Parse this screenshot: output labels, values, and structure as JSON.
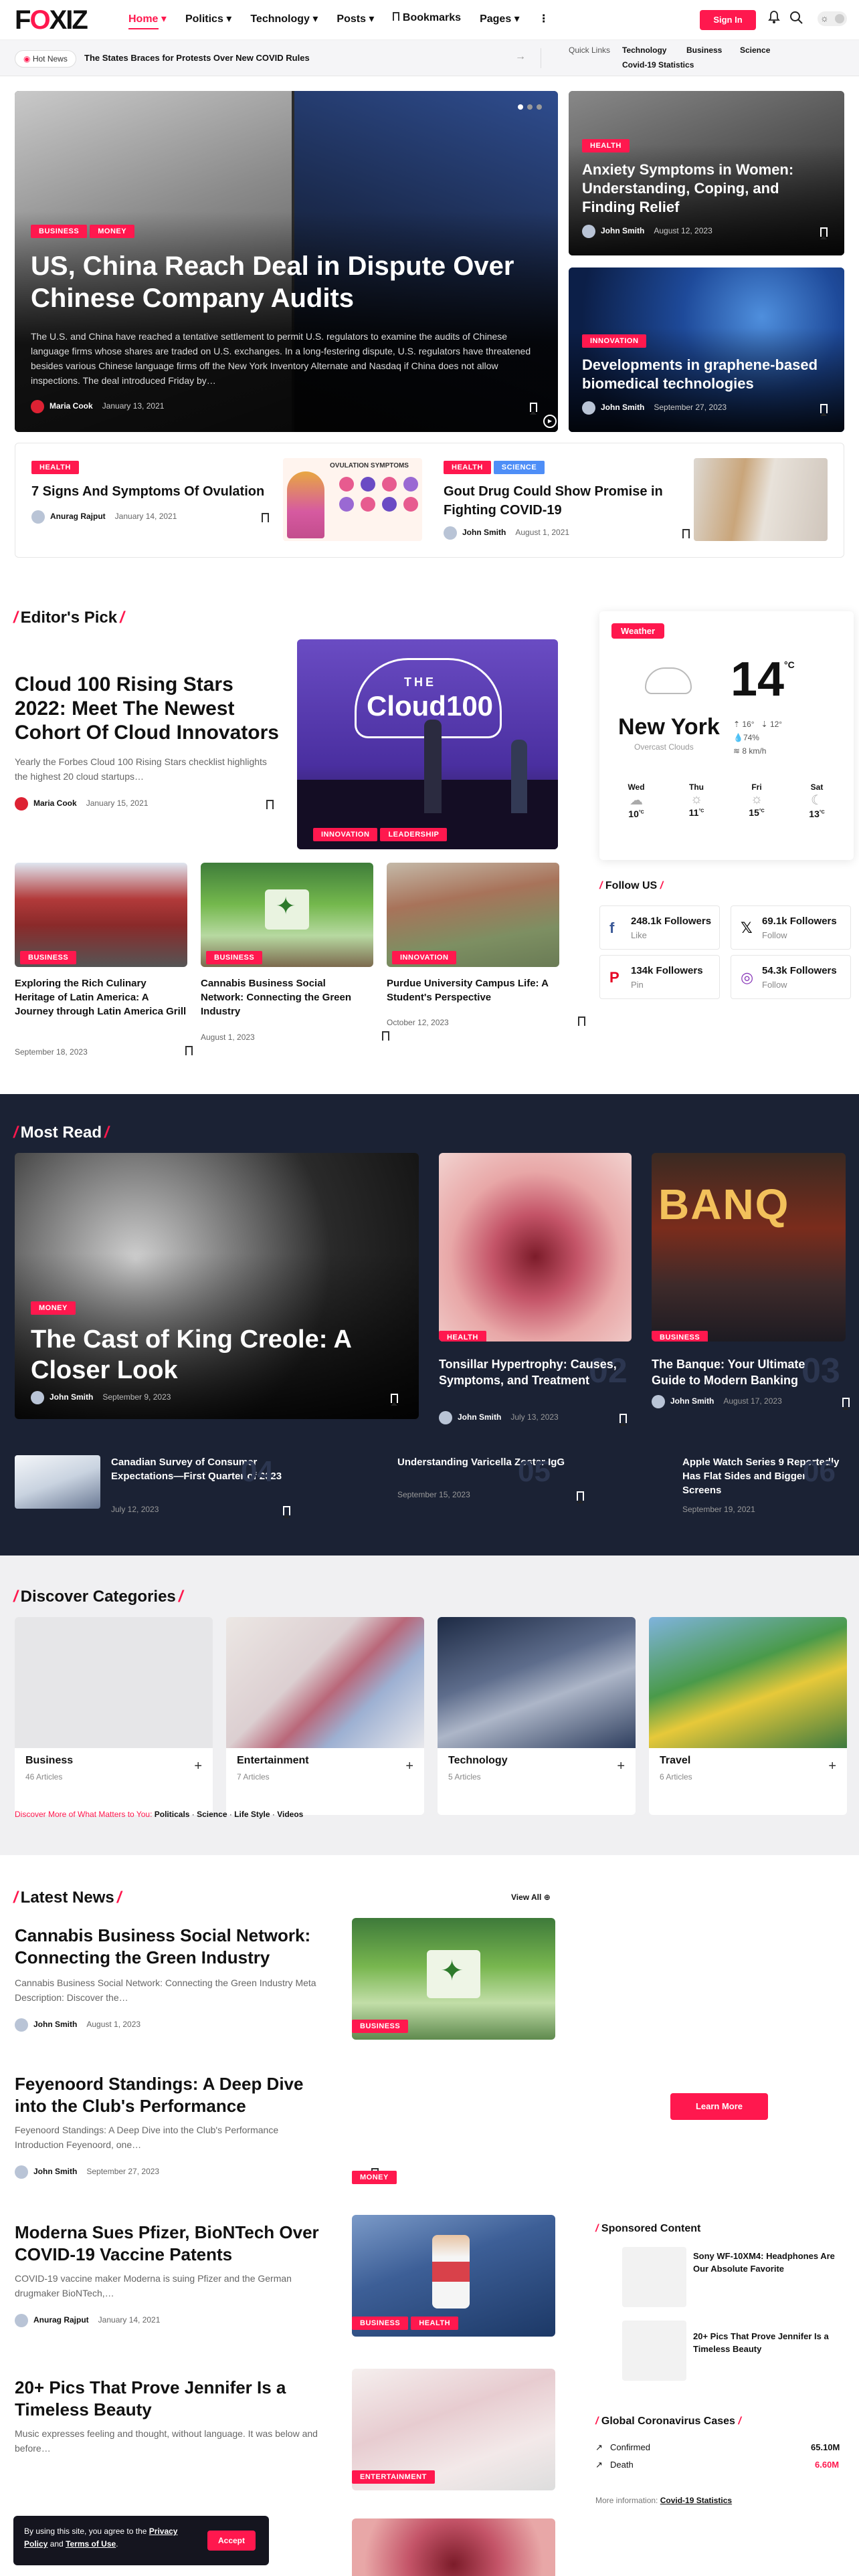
{
  "header": {
    "logo_pre": "F",
    "logo_accent": "O",
    "logo_post": "XIZ",
    "nav": [
      "Home",
      "Politics",
      "Technology",
      "Posts",
      "Bookmarks",
      "Pages"
    ],
    "sign_in": "Sign In"
  },
  "trending": {
    "badge": "Hot News",
    "headline": "The States Braces for Protests Over New COVID Rules",
    "quick_label": "Quick Links",
    "quick_links": [
      "Technology",
      "Business",
      "Science",
      "Covid-19 Statistics"
    ]
  },
  "hero": {
    "tags": [
      "BUSINESS",
      "MONEY"
    ],
    "title": "US, China Reach Deal in Dispute Over Chinese Company Audits",
    "excerpt": "The U.S. and China have reached a tentative settlement to permit U.S. regulators to examine the audits of Chinese language firms whose shares are traded on U.S. exchanges. In a long-festering dispute, U.S. regulators have threatened besides various Chinese language firms off the New York Inventory Alternate and Nasdaq if China does not allow inspections. The deal introduced Friday by…",
    "author": "Maria Cook",
    "date": "January 13, 2021"
  },
  "side_top": {
    "tag": "HEALTH",
    "title": "Anxiety Symptoms in Women: Understanding, Coping, and Finding Relief",
    "author": "John Smith",
    "date": "August 12, 2023"
  },
  "side_bottom": {
    "tag": "INNOVATION",
    "title": "Developments in graphene-based biomedical technologies",
    "author": "John Smith",
    "date": "September 27, 2023"
  },
  "strip": [
    {
      "tags": [
        "HEALTH"
      ],
      "title": "7 Signs And Symptoms Of Ovulation",
      "author": "Anurag Rajput",
      "date": "January 14, 2021",
      "img_caption": "OVULATION SYMPTOMS"
    },
    {
      "tags": [
        "HEALTH",
        "SCIENCE"
      ],
      "title": "Gout Drug Could Show Promise in Fighting COVID-19",
      "author": "John Smith",
      "date": "August 1, 2021"
    }
  ],
  "editors_pick": {
    "section": "Editor's Pick",
    "main": {
      "title": "Cloud 100 Rising Stars 2022: Meet The Newest Cohort Of Cloud Innovators",
      "excerpt": "Yearly the Forbes Cloud 100 Rising Stars checklist highlights the highest 20 cloud startups…",
      "author": "Maria Cook",
      "date": "January 15, 2021",
      "tags": [
        "INNOVATION",
        "LEADERSHIP"
      ],
      "img_text_the": "THE",
      "img_text_cloud": "Cloud100"
    },
    "cards": [
      {
        "tag": "BUSINESS",
        "title": "Exploring the Rich Culinary Heritage of Latin America: A Journey through Latin America Grill",
        "date": "September 18, 2023"
      },
      {
        "tag": "BUSINESS",
        "title": "Cannabis Business Social Network: Connecting the Green Industry",
        "date": "August 1, 2023"
      },
      {
        "tag": "INNOVATION",
        "title": "Purdue University Campus Life: A Student's Perspective",
        "date": "October 12, 2023"
      }
    ]
  },
  "weather": {
    "badge": "Weather",
    "temp": "14",
    "unit": "°C",
    "city": "New York",
    "condition": "Overcast Clouds",
    "hi": "16°",
    "lo": "12°",
    "humidity": "74%",
    "wind": "8 km/h",
    "days": [
      {
        "d": "Wed",
        "t": "10"
      },
      {
        "d": "Thu",
        "t": "11"
      },
      {
        "d": "Fri",
        "t": "15"
      },
      {
        "d": "Sat",
        "t": "13"
      }
    ],
    "deg_unit": "°C"
  },
  "follow": {
    "title": "Follow US",
    "items": [
      {
        "n": "248.1k Followers",
        "s": "Like",
        "icon": "facebook-icon",
        "glyph": "f",
        "color": "#3b5998"
      },
      {
        "n": "69.1k Followers",
        "s": "Follow",
        "icon": "x-icon",
        "glyph": "𝕏",
        "color": "#111111"
      },
      {
        "n": "134k Followers",
        "s": "Pin",
        "icon": "pinterest-icon",
        "glyph": "P",
        "color": "#e60023"
      },
      {
        "n": "54.3k Followers",
        "s": "Follow",
        "icon": "instagram-icon",
        "glyph": "◎",
        "color": "#8a3ab9"
      }
    ]
  },
  "most_read": {
    "section": "Most Read",
    "main": {
      "tag": "MONEY",
      "title": "The Cast of King Creole: A Closer Look",
      "author": "John Smith",
      "date": "September 9, 2023"
    },
    "m2": {
      "tag": "HEALTH",
      "title": "Tonsillar Hypertrophy: Causes, Symptoms, and Treatment",
      "author": "John Smith",
      "date": "July 13, 2023",
      "num": "02",
      "img_text": ""
    },
    "m3": {
      "tag": "BUSINESS",
      "title": "The Banque: Your Ultimate Guide to Modern Banking",
      "author": "John Smith",
      "date": "August 17, 2023",
      "num": "03",
      "img_text": "BANQ"
    },
    "row": [
      {
        "title": "Canadian Survey of Consumer Expectations—First Quarter of 2023",
        "date": "July 12, 2023",
        "num": "04"
      },
      {
        "title": "Understanding Varicella Zoster IgG",
        "date": "September 15, 2023",
        "num": "05"
      },
      {
        "title": "Apple Watch Series 9 Reportedly Has Flat Sides and Bigger Screens",
        "date": "September 19, 2021",
        "num": "06"
      }
    ]
  },
  "categories": {
    "section": "Discover Categories",
    "items": [
      {
        "t": "Business",
        "c": "46 Articles"
      },
      {
        "t": "Entertainment",
        "c": "7 Articles"
      },
      {
        "t": "Technology",
        "c": "5 Articles"
      },
      {
        "t": "Travel",
        "c": "6 Articles"
      }
    ],
    "more_label": "Discover More of What Matters to You:",
    "more_links": [
      "Politicals",
      "Science",
      "Life Style",
      "Videos"
    ]
  },
  "latest": {
    "section": "Latest News",
    "view_all": "View All",
    "items": [
      {
        "title": "Cannabis Business Social Network: Connecting the Green Industry",
        "excerpt": "Cannabis Business Social Network: Connecting the Green Industry Meta Description: Discover the…",
        "author": "John Smith",
        "date": "August 1, 2023",
        "tags": [
          "BUSINESS"
        ]
      },
      {
        "title": "Feyenoord Standings: A Deep Dive into the Club's Performance",
        "excerpt": "Feyenoord Standings: A Deep Dive into the Club's Performance Introduction Feyenoord, one…",
        "author": "John Smith",
        "date": "September 27, 2023",
        "tags": [
          "MONEY"
        ]
      },
      {
        "title": "Moderna Sues Pfizer, BioNTech Over COVID-19 Vaccine Patents",
        "excerpt": "COVID-19 vaccine maker Moderna is suing Pfizer and the German drugmaker BioNTech,…",
        "author": "Anurag Rajput",
        "date": "January 14, 2021",
        "tags": [
          "BUSINESS",
          "HEALTH"
        ]
      },
      {
        "title": "20+ Pics That Prove Jennifer Is a Timeless Beauty",
        "excerpt": "Music expresses feeling and thought, without language. It was below and before…",
        "author": "",
        "date": "",
        "tags": [
          "ENTERTAINMENT"
        ]
      }
    ]
  },
  "sidebar": {
    "learn_more": "Learn More",
    "sponsored_title": "Sponsored Content",
    "sponsored": [
      "Sony WF-10XM4: Headphones Are Our Absolute Favorite",
      "20+ Pics That Prove Jennifer Is a Timeless Beauty"
    ],
    "covid_title": "Global Coronavirus Cases",
    "confirmed_label": "Confirmed",
    "confirmed": "65.10M",
    "death_label": "Death",
    "death": "6.60M",
    "more_info": "More information:",
    "more_link": "Covid-19 Statistics"
  },
  "cookie": {
    "t1": "By using this site, you agree to the ",
    "privacy": "Privacy Policy",
    "t2": " and ",
    "terms": "Terms of Use",
    "t3": ".",
    "accept": "Accept"
  }
}
